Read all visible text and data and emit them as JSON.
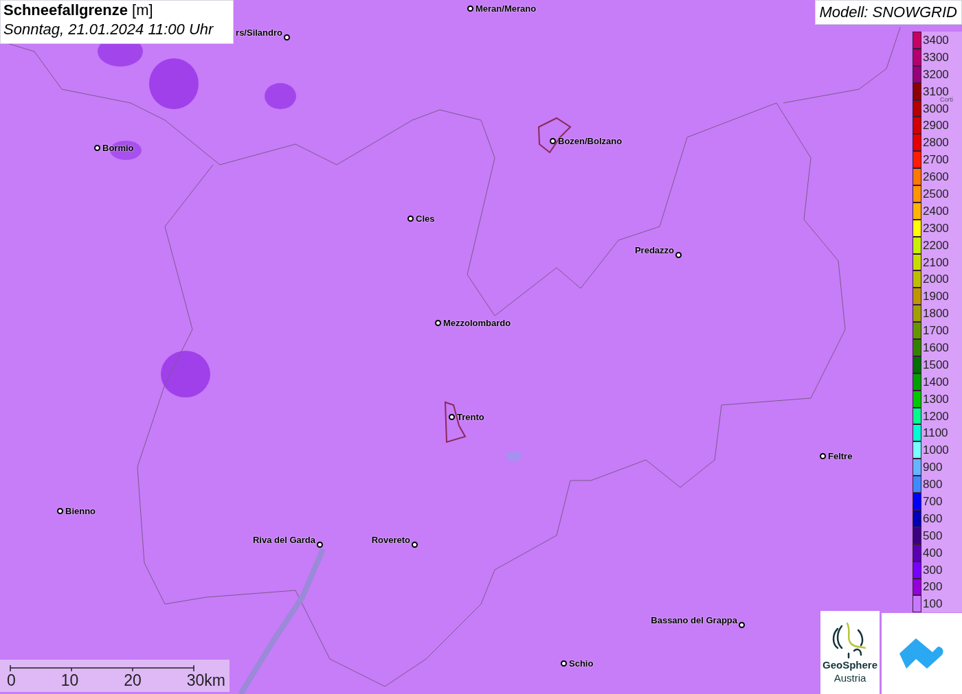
{
  "title": "**Schneefallgrenze** [m]",
  "subtitle": "Sonntag, 21.01.2024 11:00 Uhr",
  "model": "Modell: SNOWGRID",
  "cities": [
    {
      "name": "Meran/Merano"
    },
    {
      "name": "rs/Silandro"
    },
    {
      "name": "Bormio"
    },
    {
      "name": "Bozen/Bolzano"
    },
    {
      "name": "Cles"
    },
    {
      "name": "Predazzo"
    },
    {
      "name": "Mezzolombardo"
    },
    {
      "name": "Trento"
    },
    {
      "name": "Feltre"
    },
    {
      "name": "Bienno"
    },
    {
      "name": "Riva del Garda"
    },
    {
      "name": "Rovereto"
    },
    {
      "name": "Bassano del Grappa"
    },
    {
      "name": "Schio"
    }
  ],
  "edge_label": "Corti",
  "legend": [
    {
      "label": "3400",
      "color": "#c80064"
    },
    {
      "label": "3300",
      "color": "#b4006e"
    },
    {
      "label": "3200",
      "color": "#960078"
    },
    {
      "label": "3100",
      "color": "#8c0000"
    },
    {
      "label": "3000",
      "color": "#b40000"
    },
    {
      "label": "2900",
      "color": "#d20000"
    },
    {
      "label": "2800",
      "color": "#e60000"
    },
    {
      "label": "2700",
      "color": "#ff1e00"
    },
    {
      "label": "2600",
      "color": "#ff7800"
    },
    {
      "label": "2500",
      "color": "#ff9600"
    },
    {
      "label": "2400",
      "color": "#ffb400"
    },
    {
      "label": "2300",
      "color": "#ffff00"
    },
    {
      "label": "2200",
      "color": "#c8f000"
    },
    {
      "label": "2100",
      "color": "#c8dc00"
    },
    {
      "label": "2000",
      "color": "#bebe00"
    },
    {
      "label": "1900",
      "color": "#be9600"
    },
    {
      "label": "1800",
      "color": "#a0a000"
    },
    {
      "label": "1700",
      "color": "#649600"
    },
    {
      "label": "1600",
      "color": "#328200"
    },
    {
      "label": "1500",
      "color": "#006e00"
    },
    {
      "label": "1400",
      "color": "#00a000"
    },
    {
      "label": "1300",
      "color": "#00c800"
    },
    {
      "label": "1200",
      "color": "#00ff8c"
    },
    {
      "label": "1100",
      "color": "#00ffd2"
    },
    {
      "label": "1000",
      "color": "#78ffff"
    },
    {
      "label": "900",
      "color": "#64b4ff"
    },
    {
      "label": "800",
      "color": "#3c8cff"
    },
    {
      "label": "700",
      "color": "#0000ff"
    },
    {
      "label": "600",
      "color": "#0000b4"
    },
    {
      "label": "500",
      "color": "#3c0082"
    },
    {
      "label": "400",
      "color": "#5a00b4"
    },
    {
      "label": "300",
      "color": "#7800ff"
    },
    {
      "label": "200",
      "color": "#9600dc"
    },
    {
      "label": "100",
      "color": "#c878ff"
    }
  ],
  "scale": {
    "ticks": [
      "0",
      "10",
      "20",
      "30km"
    ]
  },
  "logo": {
    "line1": "GeoSphere",
    "line2": "Austria"
  }
}
